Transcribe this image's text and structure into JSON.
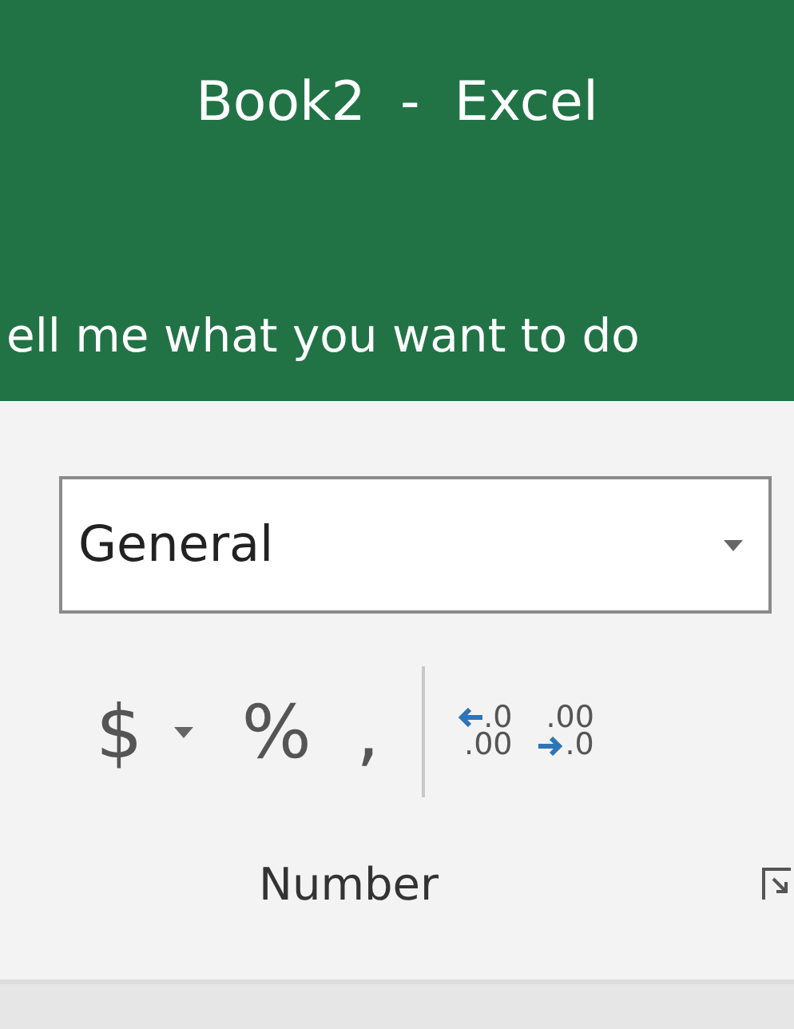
{
  "window": {
    "title": "Book2  -  Excel"
  },
  "tell_me": {
    "placeholder": "ell me what you want to do"
  },
  "number_format": {
    "value": "General"
  },
  "buttons": [
    {
      "kind": "glyph",
      "label": "$"
    },
    {
      "kind": "caret"
    },
    {
      "kind": "glyph",
      "label": "%"
    },
    {
      "kind": "glyph",
      "label": ","
    },
    {
      "kind": "separator"
    },
    {
      "kind": "decimal_left",
      "top": ".0",
      "bottom": ".00"
    },
    {
      "kind": "decimal_right",
      "top": ".00",
      "bottom": ".0"
    }
  ],
  "group": {
    "label": "Number"
  }
}
